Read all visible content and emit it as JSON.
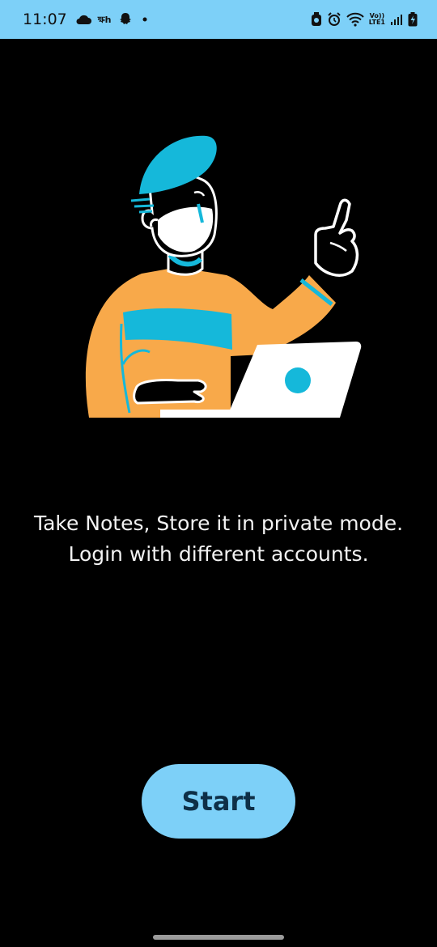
{
  "status_bar": {
    "time": "11:07",
    "left_icons": [
      "cloud-icon",
      "app-text-icon",
      "snapchat-icon",
      "dot-icon"
    ],
    "app_text": "ক্ষh",
    "network_top": "Vo))",
    "network_bottom": "LTE1",
    "right_icons": [
      "nfc-icon",
      "alarm-icon",
      "wifi-icon",
      "network-type-icon",
      "signal-icon",
      "battery-icon"
    ]
  },
  "illustration": {
    "icon": "person-with-laptop-illustration",
    "colors": {
      "shirt": "#f8a94a",
      "accent": "#15b8da",
      "laptop": "#ffffff",
      "outline": "#ffffff"
    }
  },
  "main": {
    "tagline_line1": "Take Notes, Store it in private mode.",
    "tagline_line2": "Login with different accounts.",
    "start_label": "Start"
  },
  "theme": {
    "background": "#000000",
    "accent": "#7dd0f8",
    "button_text": "#0e2f47"
  }
}
